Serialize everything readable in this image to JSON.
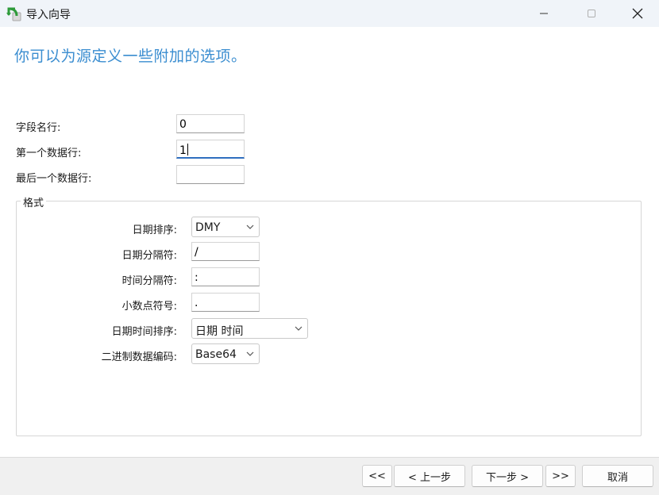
{
  "window": {
    "title": "导入向导",
    "icon": "import-wizard-icon"
  },
  "heading": "你可以为源定义一些附加的选项。",
  "fields": {
    "field_name_row": {
      "label": "字段名行:",
      "value": "0"
    },
    "first_data_row": {
      "label": "第一个数据行:",
      "value": "1"
    },
    "last_data_row": {
      "label": "最后一个数据行:",
      "value": ""
    }
  },
  "format": {
    "title": "格式",
    "date_order": {
      "label": "日期排序:",
      "value": "DMY"
    },
    "date_delimiter": {
      "label": "日期分隔符:",
      "value": "/"
    },
    "time_delimiter": {
      "label": "时间分隔符:",
      "value": ":"
    },
    "decimal_symbol": {
      "label": "小数点符号:",
      "value": "."
    },
    "datetime_order": {
      "label": "日期时间排序:",
      "value": "日期 时间"
    },
    "binary_encoding": {
      "label": "二进制数据编码:",
      "value": "Base64"
    }
  },
  "buttons": {
    "first": "<<",
    "back": "< 上一步",
    "next": "下一步 >",
    "last": ">>",
    "cancel": "取消"
  },
  "colors": {
    "heading": "#3a8dd0",
    "titlebar": "#f0f4f9",
    "focus": "#2f6fbf"
  }
}
